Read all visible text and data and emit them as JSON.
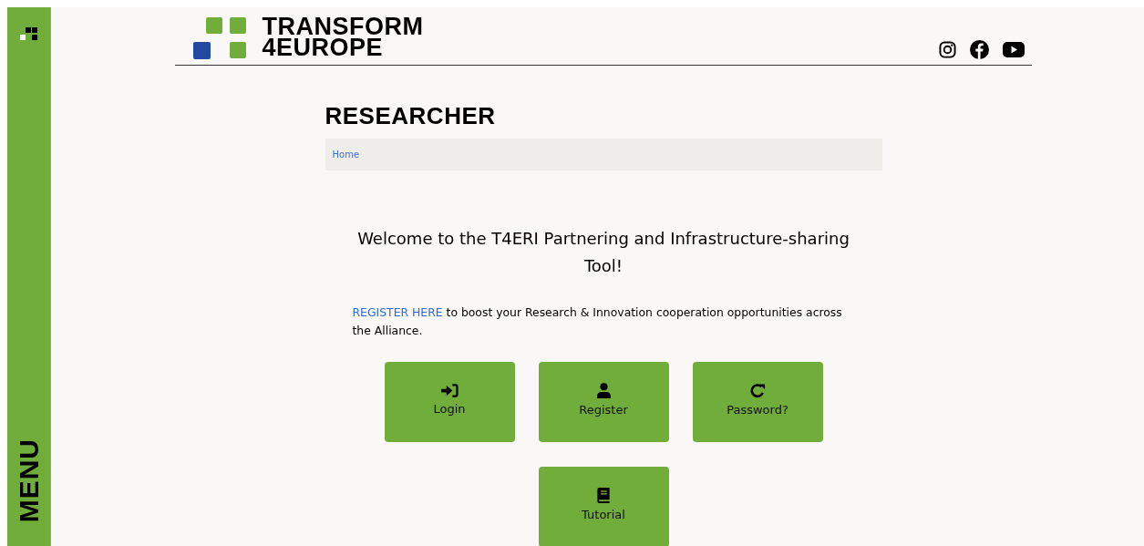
{
  "sidebar": {
    "label": "MENU"
  },
  "logo": {
    "line_1": "TRANSFORM",
    "line_2": "4EUROPE"
  },
  "social_links": [
    {
      "kind": "instagram"
    },
    {
      "kind": "facebook"
    },
    {
      "kind": "youtube"
    }
  ],
  "page_title": "RESEARCHER",
  "breadcrumb": [
    "Home"
  ],
  "welcome": "Welcome to the T4ERI Partnering and Infrastructure-sharing Tool!",
  "intro": {
    "link": "REGISTER HERE",
    "text": " to boost your Research & Innovation cooperation opportunities across the Alliance."
  },
  "actions": [
    {
      "kind": "login",
      "label": "Login"
    },
    {
      "kind": "register",
      "label": "Register"
    },
    {
      "kind": "password",
      "label": "Password?"
    },
    {
      "kind": "tutorial",
      "label": "Tutorial"
    }
  ]
}
